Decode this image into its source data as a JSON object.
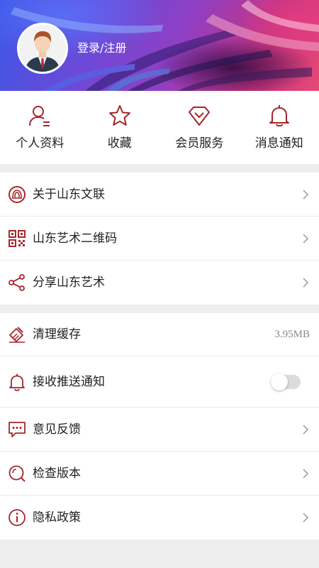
{
  "header": {
    "login_label": "登录/注册"
  },
  "quick_actions": [
    {
      "label": "个人资料",
      "icon": "person-icon"
    },
    {
      "label": "收藏",
      "icon": "star-icon"
    },
    {
      "label": "会员服务",
      "icon": "diamond-icon"
    },
    {
      "label": "消息通知",
      "icon": "bell-icon"
    }
  ],
  "menu_group_1": [
    {
      "label": "关于山东文联",
      "icon": "logo-icon"
    },
    {
      "label": "山东艺术二维码",
      "icon": "qr-code-icon"
    },
    {
      "label": "分享山东艺术",
      "icon": "share-icon"
    }
  ],
  "menu_group_2": [
    {
      "label": "清理缓存",
      "icon": "broom-icon",
      "value": "3.95MB"
    },
    {
      "label": "接收推送通知",
      "icon": "bell-icon",
      "toggle": false
    },
    {
      "label": "意见反馈",
      "icon": "chat-icon"
    },
    {
      "label": "检查版本",
      "icon": "search-icon"
    },
    {
      "label": "隐私政策",
      "icon": "info-icon"
    }
  ],
  "colors": {
    "accent": "#a4262c",
    "divider": "#ececec",
    "background": "#eeeeee"
  }
}
